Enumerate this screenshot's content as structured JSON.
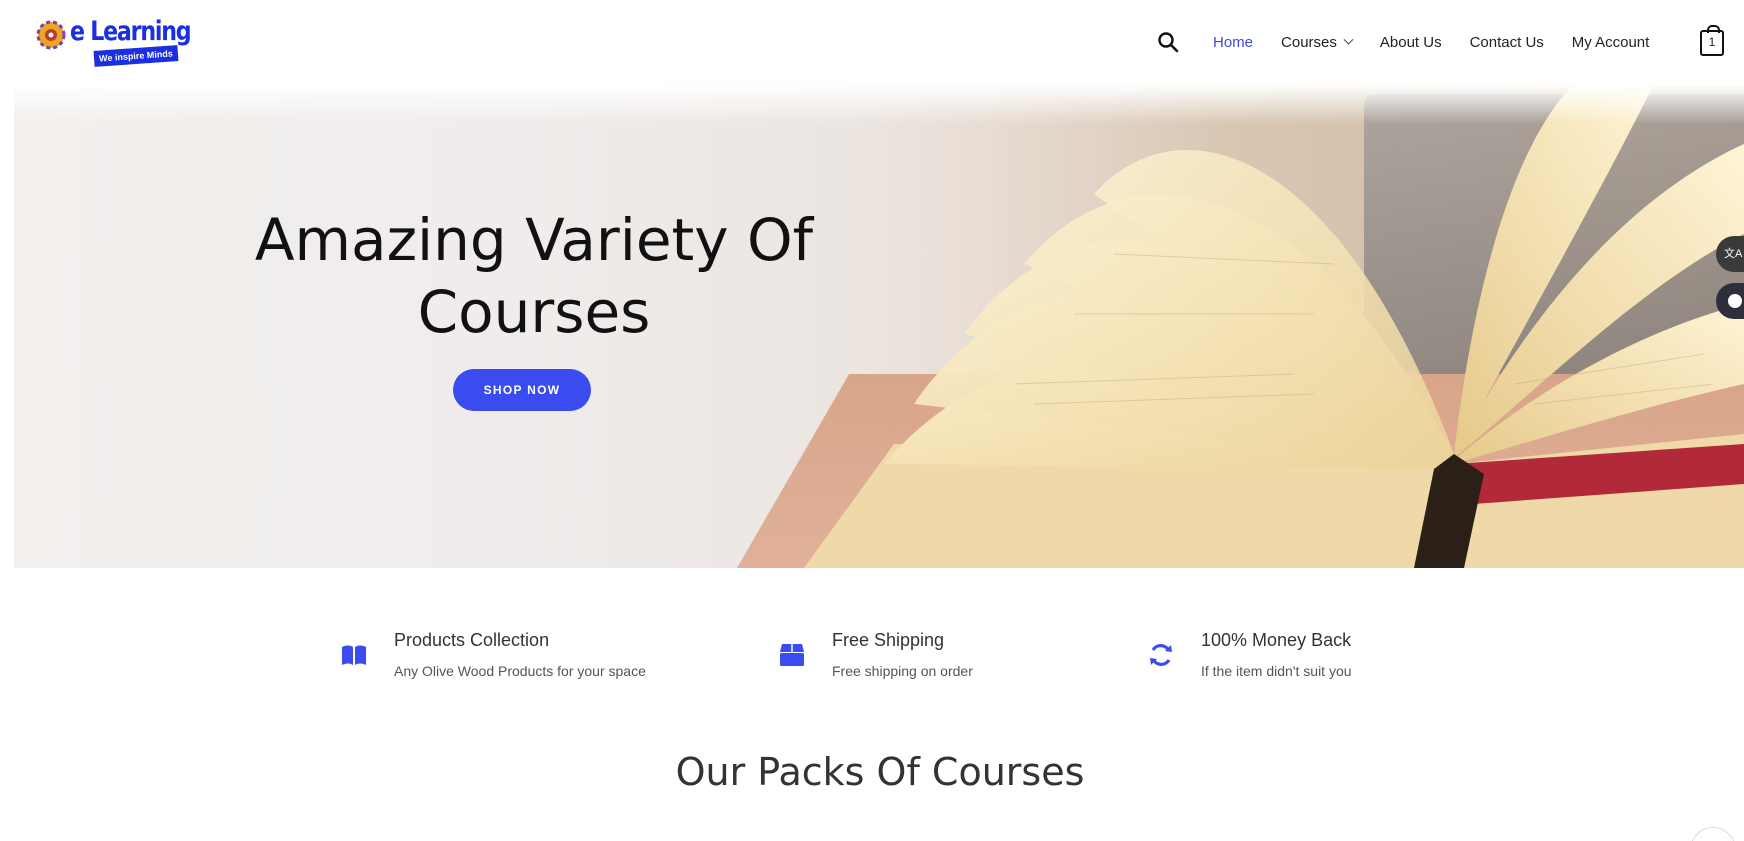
{
  "brand": {
    "name": "e Learning",
    "tagline": "We inspire Minds"
  },
  "header": {
    "search_icon": "search-icon",
    "nav": [
      {
        "label": "Home",
        "active": true
      },
      {
        "label": "Courses",
        "has_dropdown": true
      },
      {
        "label": "About Us"
      },
      {
        "label": "Contact Us"
      },
      {
        "label": "My Account"
      }
    ],
    "cart_count": "1"
  },
  "hero": {
    "title_line1": "Amazing Variety Of",
    "title_line2": "Courses",
    "button_label": "SHOP NOW"
  },
  "side_widgets": {
    "lang_label": "文A"
  },
  "features": [
    {
      "icon": "book-icon",
      "title": "Products Collection",
      "description": "Any Olive Wood Products for your space"
    },
    {
      "icon": "box-icon",
      "title": "Free Shipping",
      "description": "Free shipping on order"
    },
    {
      "icon": "refresh-icon",
      "title": "100% Money Back",
      "description": "If the item didn't suit you"
    }
  ],
  "section": {
    "title": "Our Packs Of Courses"
  },
  "colors": {
    "accent": "#3a4bf0",
    "nav_active": "#3f4bd8",
    "logo_blue": "#1a2fe0"
  }
}
